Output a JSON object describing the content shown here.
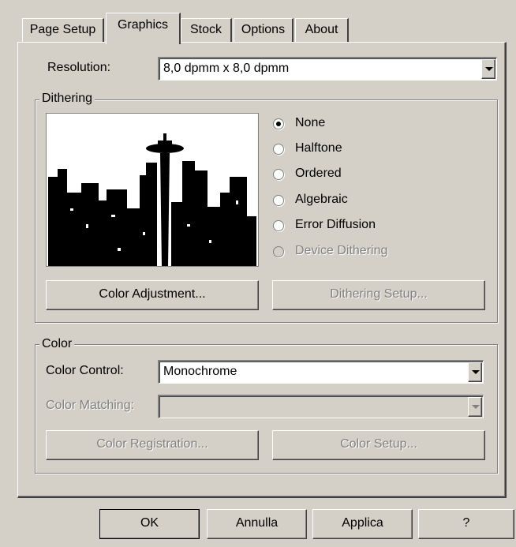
{
  "tabs": [
    {
      "label": "Page Setup"
    },
    {
      "label": "Graphics"
    },
    {
      "label": "Stock"
    },
    {
      "label": "Options"
    },
    {
      "label": "About"
    }
  ],
  "resolution": {
    "label": "Resolution:",
    "value": "8,0 dpmm x 8,0 dpmm"
  },
  "dithering": {
    "title": "Dithering",
    "options": [
      {
        "label": "None",
        "selected": true,
        "enabled": true
      },
      {
        "label": "Halftone",
        "selected": false,
        "enabled": true
      },
      {
        "label": "Ordered",
        "selected": false,
        "enabled": true
      },
      {
        "label": "Algebraic",
        "selected": false,
        "enabled": true
      },
      {
        "label": "Error Diffusion",
        "selected": false,
        "enabled": true
      },
      {
        "label": "Device Dithering",
        "selected": false,
        "enabled": false
      }
    ],
    "color_adjustment_label": "Color Adjustment...",
    "dithering_setup_label": "Dithering Setup..."
  },
  "color": {
    "title": "Color",
    "control_label": "Color Control:",
    "control_value": "Monochrome",
    "matching_label": "Color Matching:",
    "matching_value": "",
    "registration_label": "Color Registration...",
    "setup_label": "Color Setup..."
  },
  "footer": {
    "ok": "OK",
    "cancel": "Annulla",
    "apply": "Applica",
    "help": "?"
  },
  "colors": {
    "face": "#d4d0c8",
    "shadow": "#808080",
    "dark": "#404040"
  }
}
